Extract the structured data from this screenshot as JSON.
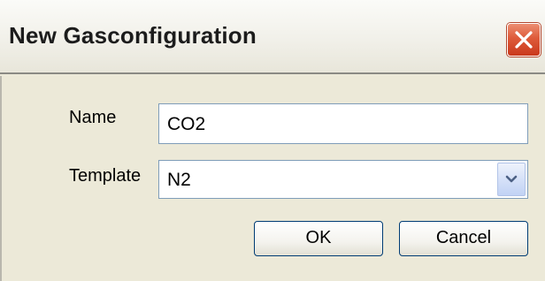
{
  "window": {
    "title": "New Gasconfiguration",
    "close_icon": "close-icon"
  },
  "form": {
    "name_label": "Name",
    "name_value": "CO2",
    "template_label": "Template",
    "template_value": "N2",
    "dropdown_icon": "chevron-down-icon"
  },
  "buttons": {
    "ok_label": "OK",
    "cancel_label": "Cancel"
  },
  "colors": {
    "dialog_background": "#ece9d8",
    "close_button": "#de5b3a",
    "field_border": "#7f9db9",
    "button_border": "#003c74"
  }
}
